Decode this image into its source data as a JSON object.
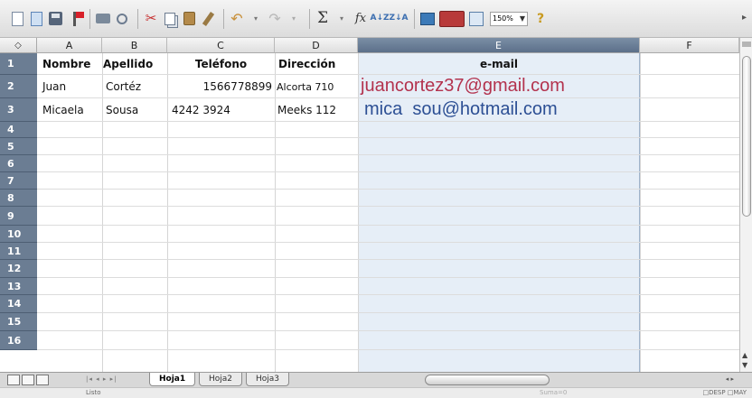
{
  "toolbar": {
    "zoom_value": "150%",
    "items": [
      "new-document",
      "open",
      "save",
      "flag",
      "print",
      "preview",
      "cut",
      "copy",
      "paste",
      "format-paintbrush",
      "undo",
      "redo",
      "autosum",
      "function",
      "sort-ascending",
      "sort-descending",
      "insert-chart",
      "toolbox",
      "gallery",
      "zoom",
      "help"
    ]
  },
  "sheet": {
    "corner_symbol": "◇",
    "columns": [
      {
        "letter": "A",
        "selected": false
      },
      {
        "letter": "B",
        "selected": false
      },
      {
        "letter": "C",
        "selected": false
      },
      {
        "letter": "D",
        "selected": false
      },
      {
        "letter": "E",
        "selected": true
      },
      {
        "letter": "F",
        "selected": false
      }
    ],
    "rows": [
      "1",
      "2",
      "3",
      "4",
      "5",
      "6",
      "7",
      "8",
      "9",
      "10",
      "11",
      "12",
      "13",
      "14",
      "15",
      "16"
    ],
    "header_row": {
      "a": "Nombre",
      "b": "Apellido",
      "c": "Teléfono",
      "d": "Dirección",
      "e": "e-mail"
    },
    "row2": {
      "a": "Juan",
      "b": "Cortéz",
      "c": "1566778899",
      "d": "Alcorta 710",
      "e": "juancortez37@gmail.com"
    },
    "row3": {
      "a": "Micaela",
      "b": "Sousa",
      "c": "4242 3924",
      "d": "Meeks 112",
      "e": "mica  sou@hotmail.com"
    }
  },
  "tabs": [
    "Hoja1",
    "Hoja2",
    "Hoja3"
  ],
  "active_tab": "Hoja1",
  "statusbar": {
    "left": "Listo",
    "middle": "Suma=0",
    "right": "□DESP  □MAY"
  },
  "colors": {
    "email_row2": "#b3324d",
    "email_row3": "#2c4f94",
    "row_header": "#6b7d93",
    "selected_column": "#e6eef7"
  }
}
